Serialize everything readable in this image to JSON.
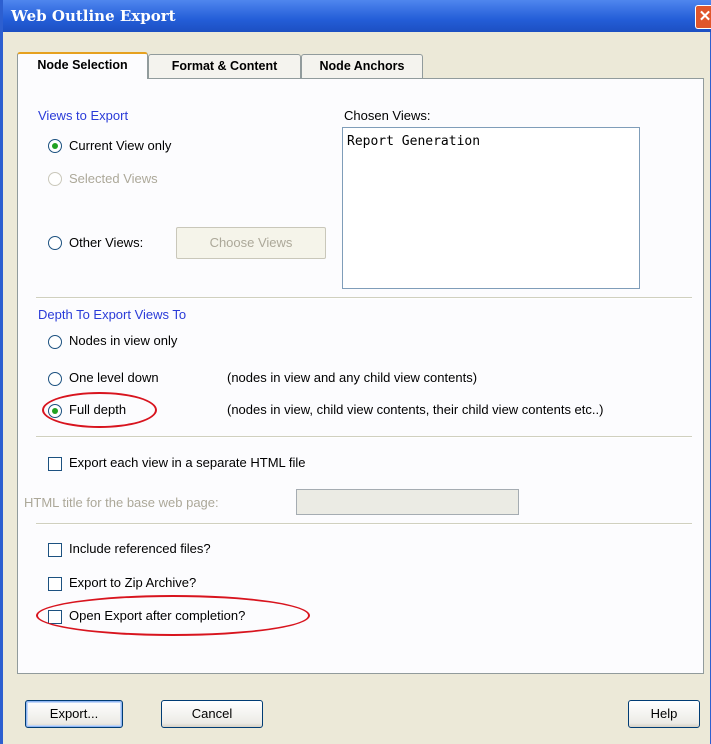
{
  "window": {
    "title": "Web Outline Export",
    "close_glyph": "✕"
  },
  "tabs": [
    {
      "label": "Node Selection",
      "active": true
    },
    {
      "label": "Format & Content",
      "active": false
    },
    {
      "label": "Node Anchors",
      "active": false
    }
  ],
  "views_to_export": {
    "title": "Views to Export",
    "options": [
      {
        "label": "Current View only",
        "checked": true,
        "enabled": true
      },
      {
        "label": "Selected Views",
        "checked": false,
        "enabled": false
      },
      {
        "label": "Other Views:",
        "checked": false,
        "enabled": true
      }
    ],
    "choose_views_button": "Choose Views"
  },
  "chosen_views": {
    "label": "Chosen Views:",
    "items": [
      "Report Generation"
    ]
  },
  "depth": {
    "title": "Depth To Export Views To",
    "options": [
      {
        "label": "Nodes in view only",
        "description": "",
        "checked": false
      },
      {
        "label": "One level down",
        "description": "(nodes in view and any child view contents)",
        "checked": false
      },
      {
        "label": "Full depth",
        "description": "(nodes in view, child view contents, their child view contents etc..)",
        "checked": true
      }
    ]
  },
  "separate_html": {
    "label": "Export each view in a separate HTML file",
    "checked": false
  },
  "html_title": {
    "label": "HTML title for the base web page:",
    "value": ""
  },
  "options": {
    "include_referenced": {
      "label": "Include referenced files?",
      "checked": false
    },
    "export_zip": {
      "label": "Export to Zip Archive?",
      "checked": false
    },
    "open_after": {
      "label": "Open Export after completion?",
      "checked": false
    }
  },
  "buttons": {
    "export": "Export...",
    "cancel": "Cancel",
    "help": "Help"
  },
  "colors": {
    "section_title": "#2a3bd8",
    "highlight": "#d8141e",
    "titlebar": "#245ed8",
    "radio_dot": "#21a121"
  }
}
